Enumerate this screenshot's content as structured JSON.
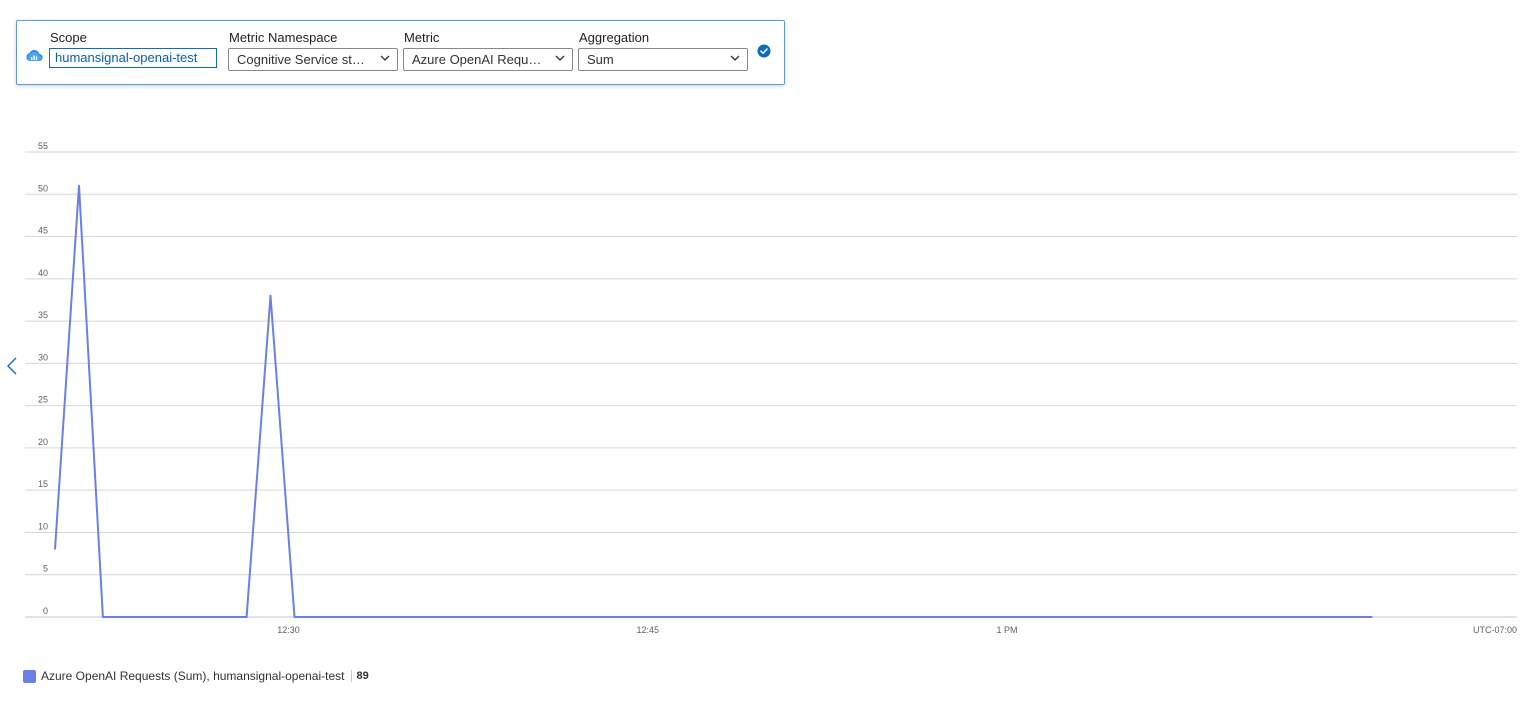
{
  "toolbar": {
    "scope": {
      "label": "Scope",
      "value": "humansignal-openai-test",
      "icon": "cloud-resource-icon"
    },
    "namespace": {
      "label": "Metric Namespace",
      "value": "Cognitive Service st…"
    },
    "metric": {
      "label": "Metric",
      "value": "Azure OpenAI Requ…"
    },
    "aggregation": {
      "label": "Aggregation",
      "value": "Sum"
    },
    "confirm_icon": "checkmark-circle-icon"
  },
  "colors": {
    "series": "#6b7fe8",
    "accent": "#0f6cbd",
    "grid": "#d6d6d6"
  },
  "chart_data": {
    "type": "line",
    "y_ticks": [
      "0",
      "5",
      "10",
      "15",
      "20",
      "25",
      "30",
      "35",
      "40",
      "45",
      "50",
      "55"
    ],
    "ylim": [
      0,
      55
    ],
    "x_ticks": [
      "12:30",
      "12:45",
      "1 PM",
      "UTC-07:00"
    ],
    "timezone_label": "UTC-07:00",
    "series": [
      {
        "name": "Azure OpenAI Requests (Sum), humansignal-openai-test",
        "points": [
          [
            "12:20",
            8
          ],
          [
            "12:21",
            51
          ],
          [
            "12:22",
            0
          ],
          [
            "12:23",
            0
          ],
          [
            "12:24",
            0
          ],
          [
            "12:25",
            0
          ],
          [
            "12:26",
            0
          ],
          [
            "12:27",
            0
          ],
          [
            "12:28",
            0
          ],
          [
            "12:29",
            38
          ],
          [
            "12:30",
            0
          ],
          [
            "12:31",
            0
          ],
          [
            "12:32",
            0
          ],
          [
            "12:33",
            0
          ],
          [
            "12:34",
            0
          ],
          [
            "12:35",
            0
          ],
          [
            "12:36",
            0
          ],
          [
            "12:37",
            0
          ],
          [
            "12:38",
            0
          ],
          [
            "12:39",
            0
          ],
          [
            "12:40",
            0
          ],
          [
            "12:41",
            0
          ],
          [
            "12:42",
            0
          ],
          [
            "12:43",
            0
          ],
          [
            "12:44",
            0
          ],
          [
            "12:45",
            0
          ],
          [
            "12:46",
            0
          ],
          [
            "12:47",
            0
          ],
          [
            "12:48",
            0
          ],
          [
            "12:49",
            0
          ],
          [
            "12:50",
            0
          ],
          [
            "12:51",
            0
          ],
          [
            "12:52",
            0
          ],
          [
            "12:53",
            0
          ],
          [
            "12:54",
            0
          ],
          [
            "12:55",
            0
          ],
          [
            "12:56",
            0
          ],
          [
            "12:57",
            0
          ],
          [
            "12:58",
            0
          ],
          [
            "12:59",
            0
          ],
          [
            "13:00",
            0
          ],
          [
            "13:01",
            0
          ],
          [
            "13:02",
            0
          ],
          [
            "13:03",
            0
          ],
          [
            "13:04",
            0
          ],
          [
            "13:05",
            0
          ],
          [
            "13:06",
            0
          ],
          [
            "13:07",
            0
          ],
          [
            "13:08",
            0
          ],
          [
            "13:09",
            0
          ],
          [
            "13:10",
            0
          ],
          [
            "13:11",
            0
          ],
          [
            "13:12",
            0
          ],
          [
            "13:13",
            0
          ],
          [
            "13:14",
            0
          ],
          [
            "13:15",
            0
          ]
        ]
      }
    ],
    "grid": true,
    "legend_position": "bottom-left"
  },
  "legend": {
    "label": "Azure OpenAI Requests (Sum), humansignal-openai-test",
    "value": "89"
  }
}
